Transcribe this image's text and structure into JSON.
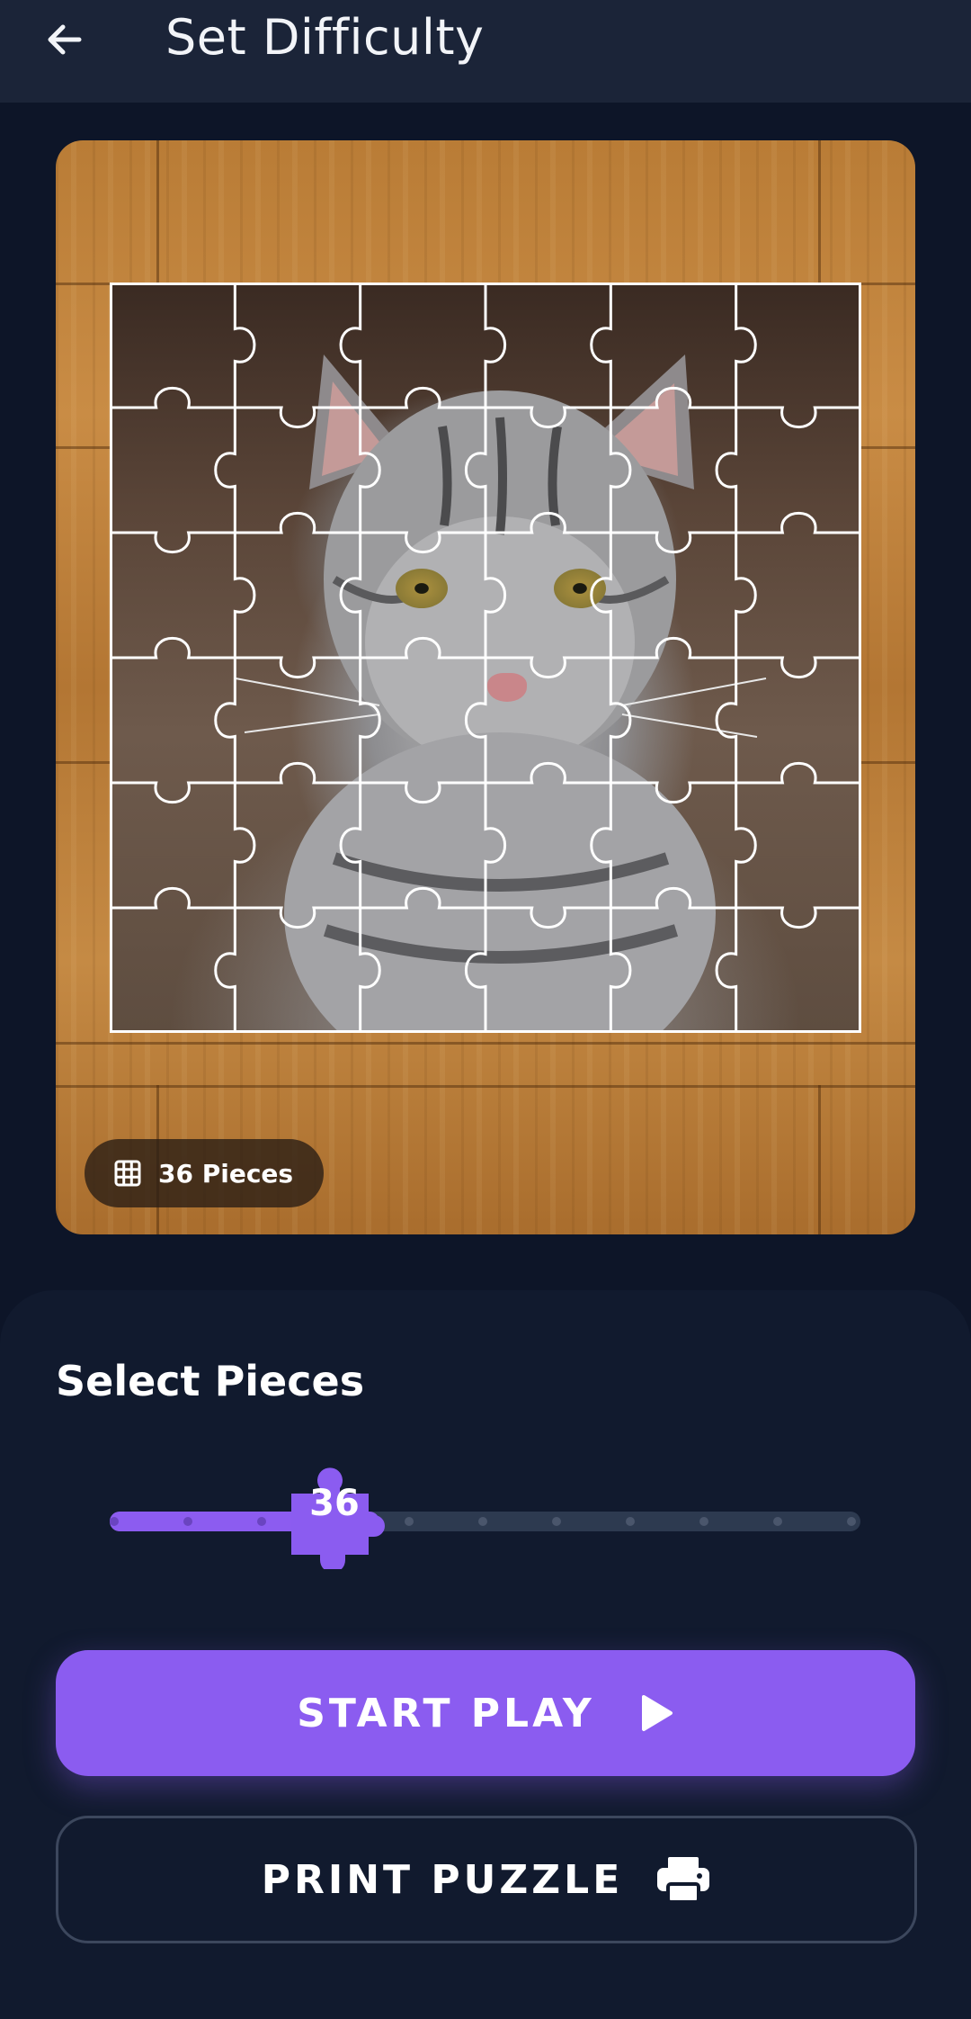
{
  "header": {
    "title": "Set Difficulty",
    "back_icon": "arrow-left-icon"
  },
  "preview": {
    "image_subject": "tabby cat",
    "grid": {
      "rows": 6,
      "cols": 6
    },
    "pieces_label": "36 Pieces",
    "chip_icon": "grid-icon"
  },
  "selector": {
    "title": "Select Pieces",
    "current_value": "36",
    "steps": 11,
    "selected_step": 3
  },
  "actions": {
    "start_label": "START PLAY",
    "start_icon": "play-icon",
    "print_label": "PRINT PUZZLE",
    "print_icon": "printer-icon"
  },
  "colors": {
    "accent": "#8b5cf0",
    "background": "#0d1528",
    "header_bg": "#1b2438",
    "panel_bg": "#111a2e",
    "track": "#2d3a50"
  }
}
